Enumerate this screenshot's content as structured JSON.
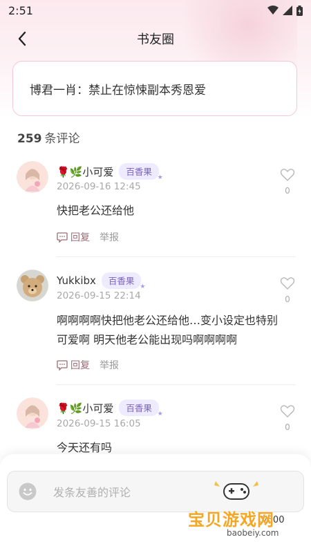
{
  "status_bar": {
    "time": "2:51"
  },
  "header": {
    "title": "书友圈",
    "back_icon": "chevron-left-icon"
  },
  "topic": {
    "text": "博君一肖：禁止在惊悚副本秀恩爱"
  },
  "comments_header": {
    "count": "259",
    "label": "条评论"
  },
  "comments": [
    {
      "name": "🌹🌿小可爱",
      "badge": "百香果",
      "time": "2026-09-16 12:45",
      "text": "快把老公还给他",
      "like_count": "0",
      "reply_label": "回复",
      "report_label": "举报"
    },
    {
      "name": "Yukkibx",
      "badge": "百香果",
      "time": "2026-09-15 22:14",
      "text": "啊啊啊啊快把他老公还给他…变小设定也特别可爱啊 明天他老公能出现吗啊啊啊啊",
      "like_count": "0",
      "reply_label": "回复",
      "report_label": "举报"
    },
    {
      "name": "🌹🌿小可爱",
      "badge": "百香果",
      "time": "2026-09-15 16:05",
      "text": "今天还有吗",
      "like_count": "0"
    }
  ],
  "composer": {
    "placeholder": "发条友善的评论",
    "char_count": "0/500",
    "emoji_icon": "smiley-icon"
  },
  "watermark": {
    "text": "宝贝游戏网",
    "url": "baobeiy.com"
  },
  "colors": {
    "accent_pink": "#f3c6d2",
    "badge_purple": "#7a63c4",
    "watermark_orange": "#f5a623"
  }
}
